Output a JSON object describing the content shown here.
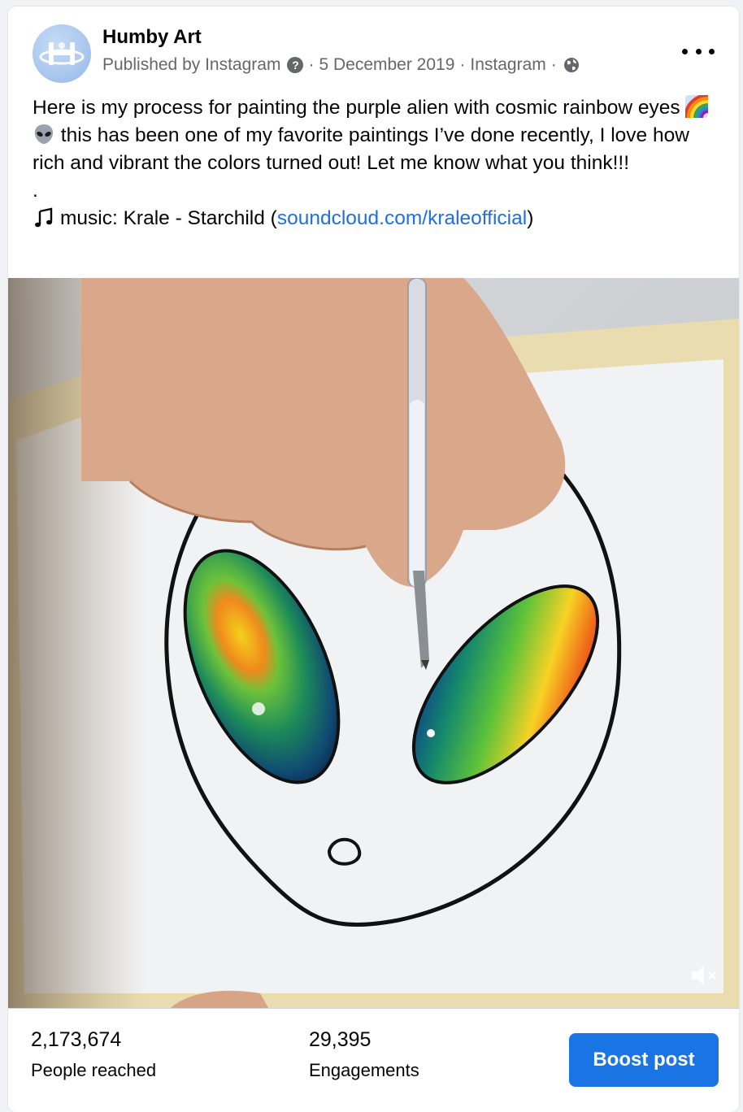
{
  "post": {
    "page_name": "Humby Art",
    "published_by": "Published by Instagram",
    "separator": "·",
    "date": "5 December 2019",
    "source": "Instagram",
    "more_icon": "more-horizontal-icon",
    "help_icon": "question-icon",
    "audience_icon": "globe-icon",
    "caption": {
      "line1_before_emoji": "Here is my process for painting the purple alien with cosmic rainbow eyes",
      "line1_after_emoji": " this has been one of my favorite paintings I’ve done recently, I love how rich and vibrant the colors turned out! Let me know what you think!!!",
      "dot": ".",
      "music_prefix": "music: Krale - Starchild (",
      "music_link": "soundcloud.com/kraleofficial",
      "music_suffix": ")"
    },
    "emojis": [
      "rainbow-emoji",
      "alien-emoji"
    ],
    "video": {
      "subject": "hand painting alien with rainbow watercolor eyes",
      "muted": true,
      "sound_icon": "speaker-muted-icon"
    }
  },
  "insights": {
    "reach": {
      "value": "2,173,674",
      "label": "People reached"
    },
    "engagements": {
      "value": "29,395",
      "label": "Engagements"
    },
    "boost_label": "Boost post"
  },
  "colors": {
    "link": "#216fdb",
    "boost": "#1b74e4",
    "secondary_text": "#65676b"
  }
}
